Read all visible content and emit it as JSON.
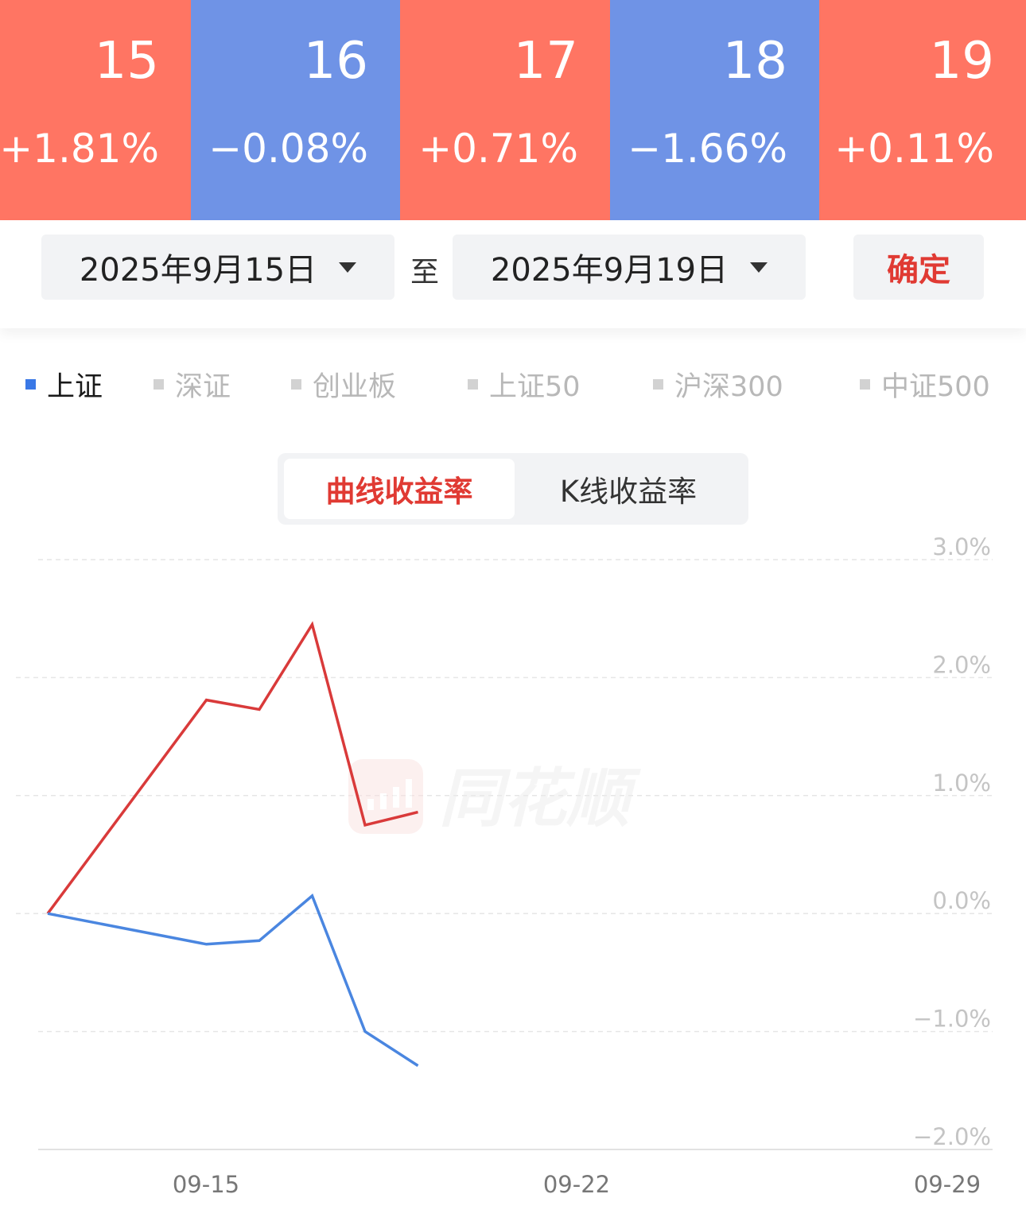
{
  "day_tiles": [
    {
      "day": "15",
      "change": "+1.81%",
      "direction": "up"
    },
    {
      "day": "16",
      "change": "−0.08%",
      "direction": "down"
    },
    {
      "day": "17",
      "change": "+0.71%",
      "direction": "up"
    },
    {
      "day": "18",
      "change": "−1.66%",
      "direction": "down"
    },
    {
      "day": "19",
      "change": "+0.11%",
      "direction": "up"
    }
  ],
  "colors": {
    "up": "#ff7563",
    "down": "#6f93e6",
    "accent_red": "#e03a33",
    "accent_blue": "#3a78e6"
  },
  "date_range": {
    "start": "2025年9月15日",
    "separator": "至",
    "end": "2025年9月19日",
    "confirm_label": "确定"
  },
  "indices": [
    {
      "label": "上证",
      "active": true
    },
    {
      "label": "深证",
      "active": false
    },
    {
      "label": "创业板",
      "active": false
    },
    {
      "label": "上证50",
      "active": false
    },
    {
      "label": "沪深300",
      "active": false
    },
    {
      "label": "中证500",
      "active": false
    }
  ],
  "chart_toggle": {
    "curve": "曲线收益率",
    "kline": "K线收益率",
    "selected": "curve"
  },
  "watermark": "同花顺",
  "chart_data": {
    "type": "line",
    "x": [
      "09-12",
      "09-15",
      "09-16",
      "09-17",
      "09-18",
      "09-19"
    ],
    "series": [
      {
        "color": "#d93a3a",
        "values": [
          0.0,
          1.81,
          1.73,
          2.45,
          0.75,
          0.86
        ]
      },
      {
        "color": "#4a86e0",
        "values": [
          0.0,
          -0.26,
          -0.23,
          0.15,
          -1.0,
          -1.29
        ]
      }
    ],
    "ylim": [
      -2.0,
      3.0
    ],
    "ytick_labels": [
      "3.0%",
      "2.0%",
      "1.0%",
      "0.0%",
      "−1.0%",
      "−2.0%"
    ],
    "xtick_labels": [
      "09-15",
      "09-22",
      "09-29"
    ],
    "grid": true,
    "legend": "none"
  }
}
